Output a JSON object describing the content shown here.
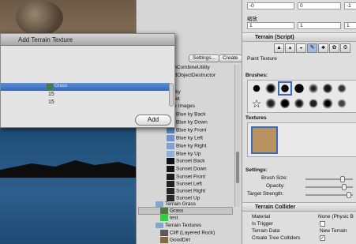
{
  "dialog": {
    "title": "Add Terrain Texture",
    "selected_texture": "Grass",
    "value_1": "15",
    "value_2": "15",
    "add_label": "Add"
  },
  "project": {
    "settings_label": "Settings...",
    "create_label": "Create",
    "items": [
      "shCombineUtility",
      "edObjectDestructor",
      "sky",
      "set",
      "ce Images",
      "Blue ky Back",
      "Blue ky Down",
      "Blue ky Front",
      "Blue ky Left",
      "Blue ky Right",
      "Blue ky Up",
      "Sunset Back",
      "Sunset Down",
      "Sunset Front",
      "Sunset Left",
      "Sunset Right",
      "Sunset Up"
    ],
    "folder_terrain_grass": "Terrain Grass",
    "grass_item": "Grass",
    "test_item": "test",
    "folder_terrain_textures": "Terrain Textures",
    "cliff_item": "Cliff (Layered Rock)",
    "good_dirt_item": "GoodDirt"
  },
  "inspector": {
    "field_a": "-0",
    "field_b": "0",
    "field_c": "-1",
    "scale_label": "缩放",
    "scale_x": "1",
    "scale_y": "1",
    "scale_z": "1",
    "terrain_script_label": "Terrain (Script)",
    "paint_texture_label": "Paint Texture",
    "brushes_label": "Brushes:",
    "textures_label": "Textures",
    "settings_label": "Settings:",
    "brush_size_label": "Brush Size:",
    "opacity_label": "Opacity:",
    "target_strength_label": "Target Strength:",
    "terrain_collider_label": "Terrain Collider",
    "material_label": "Material",
    "material_value": "None (Physic B",
    "is_trigger_label": "Is Trigger",
    "terrain_data_label": "Terrain Data",
    "terrain_data_value": "New Terrain",
    "create_tree_colliders_label": "Create Tree Colliders"
  },
  "colors": {
    "selection": "#3468b8",
    "texture_swatch": "#b99362",
    "grass_swatch": "#4d7a3a"
  }
}
